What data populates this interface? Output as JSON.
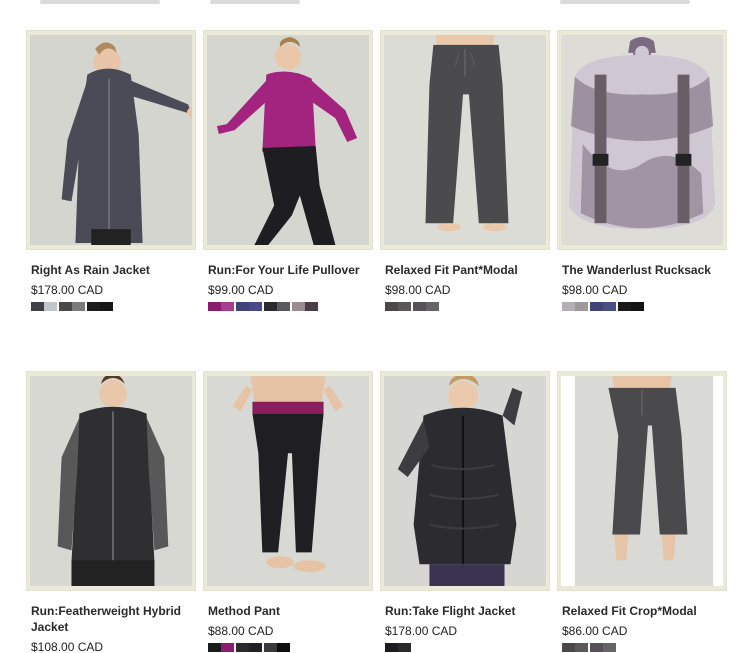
{
  "products": [
    {
      "name": "Right As Rain Jacket",
      "price": "$178.00 CAD",
      "colors": {
        "bg": "#d4d5cf",
        "garment": "#4a4b57",
        "accent": "#6b6c78",
        "skin": "#e8c5a8"
      },
      "swatches": [
        [
          "#3e4048",
          "#c3c6c8"
        ],
        [
          "#4a4849",
          "#7b7a7c"
        ],
        [
          "#1c1c1c",
          "#151515"
        ]
      ]
    },
    {
      "name": "Run:For Your Life Pullover",
      "price": "$99.00 CAD",
      "colors": {
        "bg": "#d6d6d0",
        "garment": "#a2247e",
        "accent": "#1e1e22",
        "skin": "#eac7aa"
      },
      "swatches": [
        [
          "#8c1a6e",
          "#a83b8b"
        ],
        [
          "#3e4379",
          "#474c86"
        ],
        [
          "#2a2a2c",
          "#5a5a5c"
        ],
        [
          "#9a8c90",
          "#4a3e44"
        ]
      ]
    },
    {
      "name": "Relaxed Fit Pant*Modal",
      "price": "$98.00 CAD",
      "colors": {
        "bg": "#dcdcd6",
        "garment": "#4b4a4c",
        "accent": "#5d5c5e",
        "skin": "#e9c8ac"
      },
      "swatches": [
        [
          "#4a4849",
          "#5a5859"
        ],
        [
          "#555355",
          "#666466"
        ]
      ]
    },
    {
      "name": "The Wanderlust Rucksack",
      "price": "$98.00 CAD",
      "colors": {
        "bg": "#dedcd6",
        "garment": "#7b6a80",
        "accent": "#cfc8d2",
        "skin": "#b9adbd"
      },
      "swatches": [
        [
          "#b3afb2",
          "#9d999c"
        ],
        [
          "#3f4577",
          "#4a5084"
        ],
        [
          "#1a1a1a",
          "#121212"
        ]
      ]
    },
    {
      "name": "Run:Featherweight Hybrid Jacket",
      "price": "$108.00 CAD",
      "colors": {
        "bg": "#d8d8d2",
        "garment": "#2f2e31",
        "accent": "#595859",
        "skin": "#e9c7aa"
      },
      "swatches": [
        [
          "#2b2a2c",
          "#3a393b"
        ]
      ]
    },
    {
      "name": "Method Pant",
      "price": "$88.00 CAD",
      "colors": {
        "bg": "#d8d8d4",
        "garment": "#1f1e22",
        "accent": "#8c1d5f",
        "skin": "#e7c3a5"
      },
      "swatches": [
        [
          "#1a1a1a",
          "#8d1d68"
        ],
        [
          "#2c2b2d",
          "#222124"
        ],
        [
          "#3a3a3c",
          "#0f0f0f"
        ]
      ]
    },
    {
      "name": "Run:Take Flight Jacket",
      "price": "$178.00 CAD",
      "colors": {
        "bg": "#d6d6d2",
        "garment": "#2c2b2f",
        "accent": "#3d3c40",
        "skin": "#ebc9ad"
      },
      "swatches": [
        [
          "#1d1d1f",
          "#2a2a2c"
        ]
      ]
    },
    {
      "name": "Relaxed Fit Crop*Modal",
      "price": "$86.00 CAD",
      "colors": {
        "bg": "#ffffff",
        "garment": "#4a494b",
        "accent": "#5b5a5c",
        "skin": "#e7c4a6"
      },
      "swatches": [
        [
          "#4a4849",
          "#5a5859"
        ],
        [
          "#555355",
          "#666466"
        ]
      ]
    }
  ]
}
